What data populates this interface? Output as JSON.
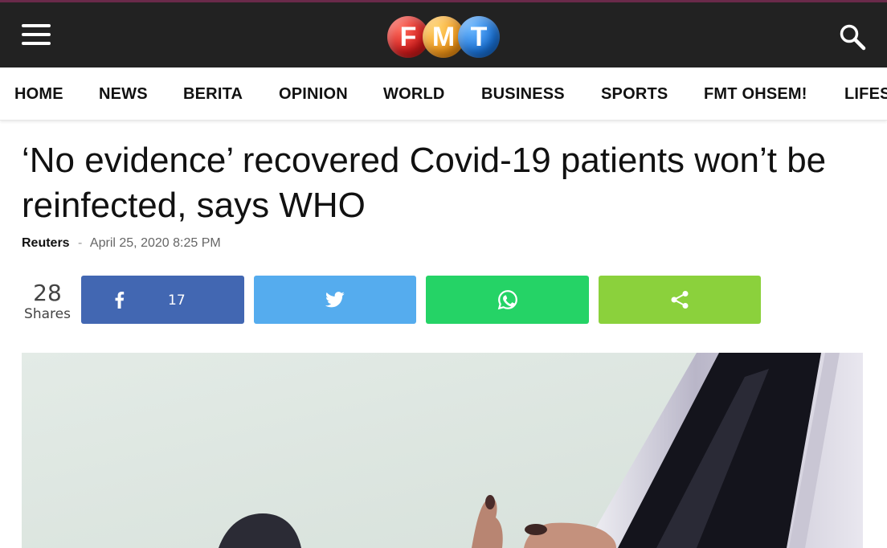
{
  "header": {
    "logo_letters": [
      "F",
      "M",
      "T"
    ],
    "brand_colors": [
      "#d21b1b",
      "#f29618",
      "#1a73d9"
    ],
    "background": "#222222",
    "menu_icon": "hamburger-menu-icon",
    "search_icon": "search-icon"
  },
  "nav": {
    "items": [
      "HOME",
      "NEWS",
      "BERITA",
      "OPINION",
      "WORLD",
      "BUSINESS",
      "SPORTS",
      "FMT OHSEM!",
      "LIFESTYLE"
    ]
  },
  "article": {
    "title": "‘No evidence’ recovered Covid-19 patients won’t be reinfected, says WHO",
    "author": "Reuters",
    "separator": "-",
    "date": "April 25, 2020 8:25 PM"
  },
  "share": {
    "total": "28",
    "label": "Shares",
    "facebook_count": "17",
    "colors": {
      "facebook": "#4267b2",
      "twitter": "#55acee",
      "whatsapp": "#25d366",
      "share": "#8bd13c"
    },
    "icons": [
      "facebook-icon",
      "twitter-icon",
      "whatsapp-icon",
      "share-icon"
    ]
  }
}
